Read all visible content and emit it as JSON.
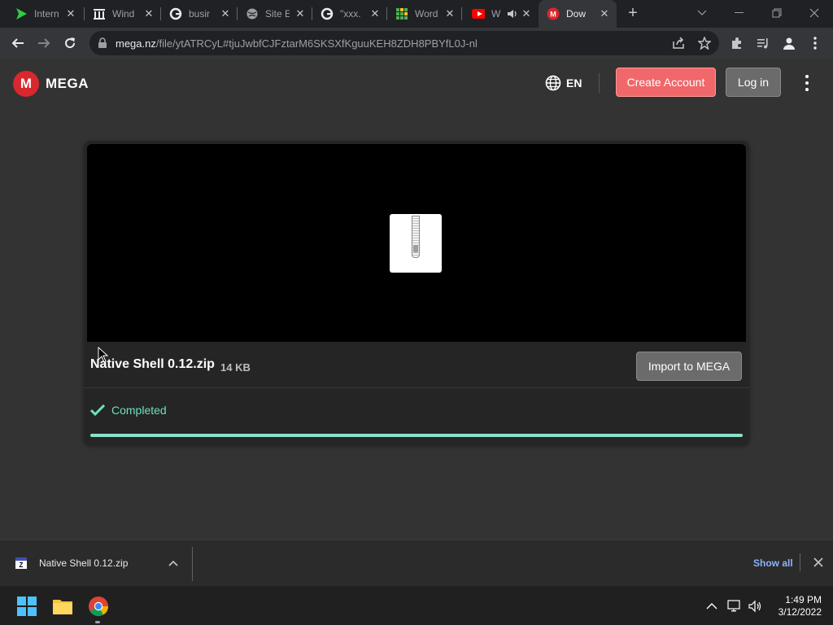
{
  "browser": {
    "tabs": [
      {
        "label": "Intern",
        "icon": "green-play-icon"
      },
      {
        "label": "Wind",
        "icon": "museum-icon"
      },
      {
        "label": "busir",
        "icon": "google-icon"
      },
      {
        "label": "Site E",
        "icon": "globe-icon"
      },
      {
        "label": "\"xxx.",
        "icon": "google-icon"
      },
      {
        "label": "Word",
        "icon": "grid-icon"
      },
      {
        "label": "W",
        "icon": "youtube-icon"
      },
      {
        "label": "Dow",
        "icon": "mega-icon",
        "active": true
      }
    ],
    "close_glyph": "✕",
    "new_tab_glyph": "+",
    "url_host": "mega.nz",
    "url_path": "/file/ytATRCyL#tjuJwbfCJFztarM6SKSXfKguuKEH8ZDH8PBYfL0J-nl"
  },
  "header": {
    "logo_letter": "M",
    "logo_text": "MEGA",
    "language": "EN",
    "create_account": "Create Account",
    "login": "Log in"
  },
  "file": {
    "name": "Native Shell 0.12.zip",
    "size": "14 KB",
    "import_button": "Import to MEGA",
    "status": "Completed",
    "progress_percent": 100
  },
  "downloads": {
    "item_name": "Native Shell 0.12.zip",
    "show_all": "Show all"
  },
  "taskbar": {
    "time": "1:49 PM",
    "date": "3/12/2022"
  },
  "colors": {
    "mega_red": "#d9272e",
    "create_button": "#f0686a",
    "completed_green": "#6fe0c0"
  }
}
